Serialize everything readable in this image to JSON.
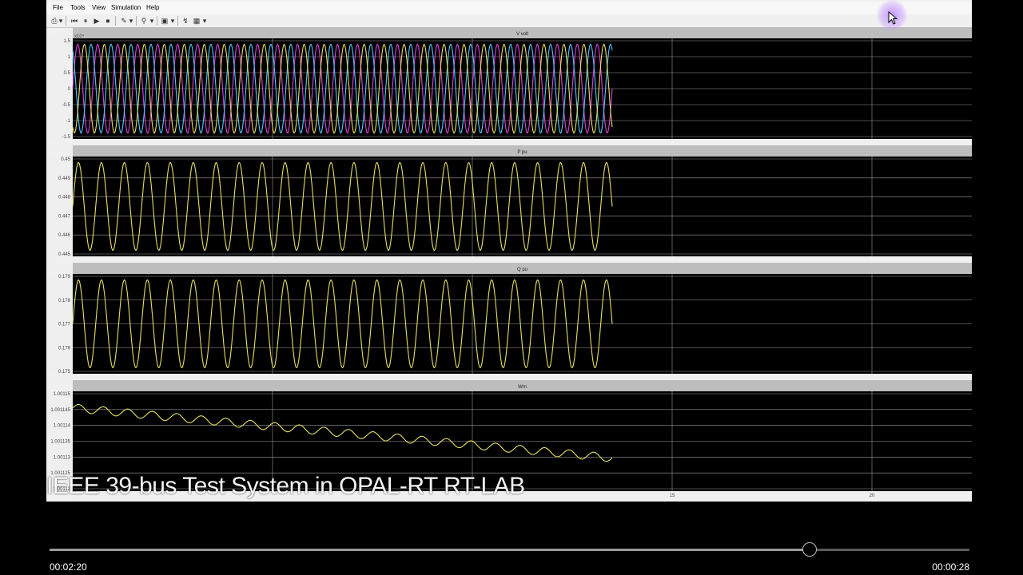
{
  "app": {
    "menu": [
      "File",
      "Tools",
      "View",
      "Simulation",
      "Help"
    ]
  },
  "toolbar": {
    "icons": [
      "printer-icon",
      "dropdown-icon",
      "step-back-icon",
      "pause-icon",
      "play-icon",
      "stop-icon",
      "highlight-icon",
      "dropdown-icon",
      "zoom-icon",
      "dropdown-icon",
      "fit-icon",
      "dropdown-icon",
      "trigger-icon",
      "style-icon",
      "dropdown-icon"
    ]
  },
  "chart_data": [
    {
      "type": "line",
      "title": "V  volt",
      "y_exponent": "x10⁴",
      "yticks": [
        "1.5",
        "1",
        "0.5",
        "0",
        "-0.5",
        "-1",
        "-1.5"
      ],
      "ylim": [
        -1.7,
        1.7
      ],
      "series": [
        {
          "color": "#e040e0"
        },
        {
          "color": "#4fc8ff"
        },
        {
          "color": "#e8e060"
        }
      ],
      "shape": {
        "kind": "sine",
        "amplitude": 1.5,
        "cycles": 27
      }
    },
    {
      "type": "line",
      "title": "P pu",
      "yticks": [
        "0.45",
        "0.449",
        "0.448",
        "0.447",
        "0.446",
        "0.445"
      ],
      "ylim": [
        0.445,
        0.45
      ],
      "series": [
        {
          "color": "#e8e060"
        }
      ],
      "shape": {
        "kind": "sine",
        "center": 0.4475,
        "amplitude": 0.0022,
        "cycles": 23.5
      }
    },
    {
      "type": "line",
      "title": "Q pu",
      "yticks": [
        "0.179",
        "0.178",
        "0.177",
        "0.176",
        "0.175"
      ],
      "ylim": [
        0.1745,
        0.1795
      ],
      "series": [
        {
          "color": "#e8e060"
        }
      ],
      "shape": {
        "kind": "sine",
        "center": 0.177,
        "amplitude": 0.0022,
        "cycles": 23.5
      }
    },
    {
      "type": "line",
      "title": "Wm",
      "yticks": [
        "1.00115",
        "1.001145",
        "1.00114",
        "1.001135",
        "1.00113",
        "1.001125",
        "1.00112"
      ],
      "ylim": [
        1.00112,
        1.00115
      ],
      "series": [
        {
          "color": "#e8e060"
        }
      ],
      "shape": {
        "kind": "trend",
        "start": 1.001145,
        "end": 1.00113
      }
    }
  ],
  "x_axis": {
    "ticks": [
      "15",
      "20"
    ]
  },
  "overlay": {
    "title": "IEEE 39-bus Test System in OPAL-RT RT-LAB"
  },
  "player": {
    "current_time": "00:02:20",
    "remaining_time": "00:00:28",
    "progress": 0.826
  }
}
